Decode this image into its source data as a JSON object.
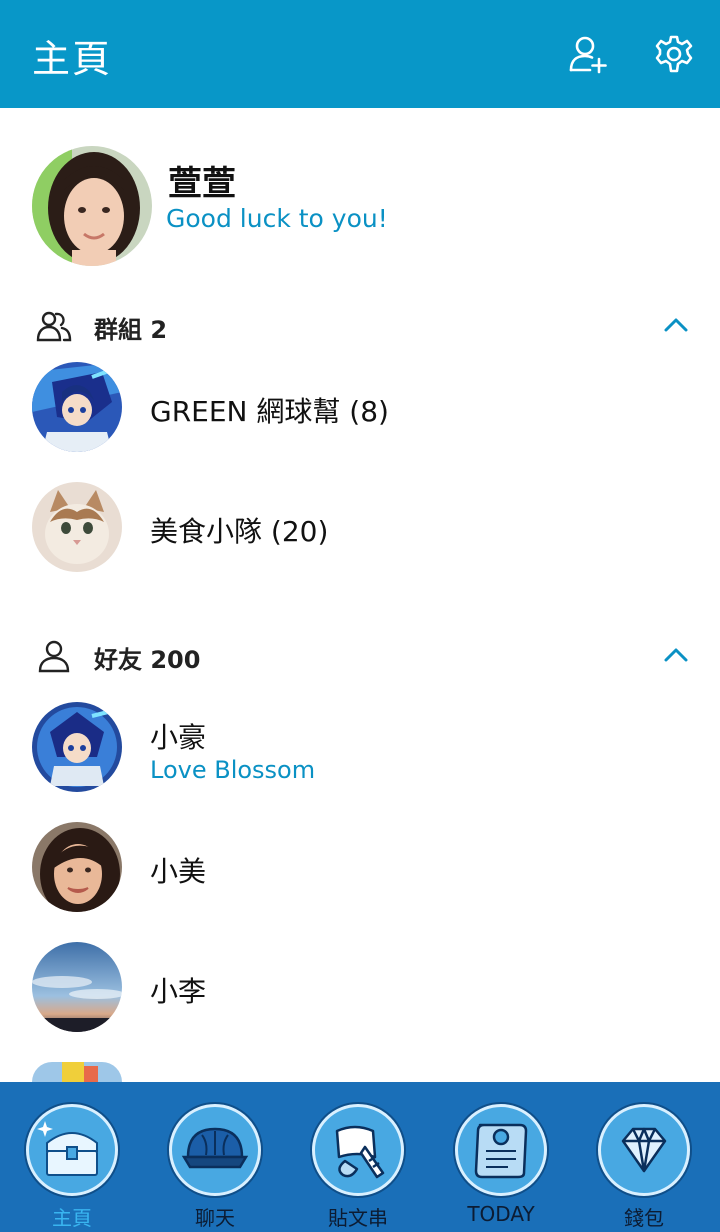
{
  "header": {
    "title": "主頁",
    "add_friend_icon": "add-friend-icon",
    "settings_icon": "gear-icon",
    "background": "#0897c8"
  },
  "profile": {
    "name": "萱萱",
    "status": "Good luck to you!"
  },
  "groups": {
    "label": "群組 2",
    "items": [
      {
        "name": "GREEN 網球幫 (8)"
      },
      {
        "name": "美食小隊 (20)"
      }
    ]
  },
  "friends": {
    "label": "好友 200",
    "items": [
      {
        "name": "小豪",
        "status": "Love Blossom"
      },
      {
        "name": "小美"
      },
      {
        "name": "小李"
      }
    ]
  },
  "tabs": [
    {
      "label": "主頁",
      "icon": "treasure-chest-icon",
      "active": true
    },
    {
      "label": "聊天",
      "icon": "chat-shell-icon",
      "active": false
    },
    {
      "label": "貼文串",
      "icon": "quill-icon",
      "active": false
    },
    {
      "label": "TODAY",
      "icon": "scroll-icon",
      "active": false
    },
    {
      "label": "錢包",
      "icon": "diamond-icon",
      "active": false
    }
  ],
  "colors": {
    "accent": "#0a91c4",
    "tabbar": "#1a6fb8",
    "active_tab": "#39b5f0"
  }
}
